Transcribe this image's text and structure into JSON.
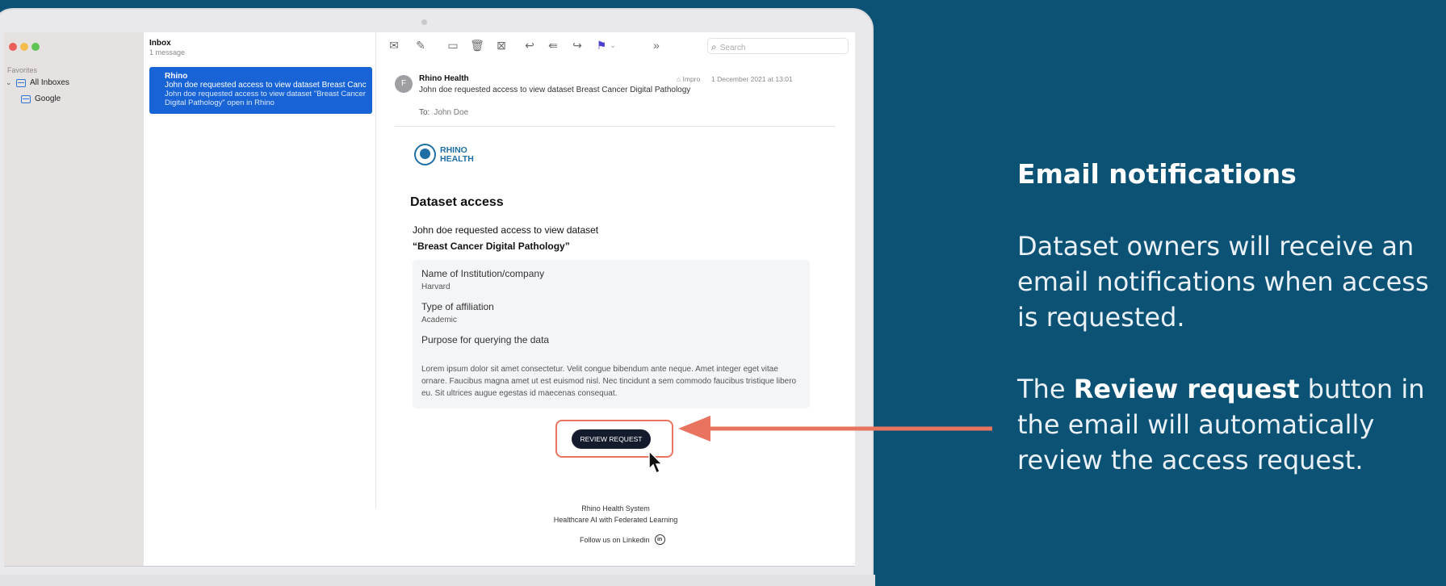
{
  "sidebar": {
    "favorites_label": "Favorites",
    "all_inboxes": "All Inboxes",
    "google": "Google"
  },
  "message_list": {
    "title": "Inbox",
    "count": "1 message",
    "item": {
      "from": "Rhino",
      "subject": "John doe requested access to view dataset Breast Canc",
      "preview": "John doe requested access to view dataset \"Breast Cancer Digital Pathology\" open in Rhino"
    }
  },
  "toolbar": {
    "icons": [
      "envelope-icon",
      "compose-icon",
      "archive-icon",
      "trash-icon",
      "junk-icon",
      "reply-icon",
      "reply-all-icon",
      "forward-icon",
      "flag-icon",
      "more-icon"
    ],
    "search_placeholder": "Search",
    "flag_color": "#4a3fcf"
  },
  "email": {
    "avatar": "F",
    "from": "Rhino Health",
    "subject": "John doe requested access to view dataset Breast Cancer Digital Pathology",
    "mailbox": "Impro",
    "date": "1 December 2021 at 13:01",
    "to_label": "To:",
    "to_value": "John Doe",
    "logo_line1": "RHINO",
    "logo_line2": "HEALTH",
    "title": "Dataset access",
    "body_line1": "John doe requested access to view dataset",
    "body_line2": "“Breast Cancer Digital Pathology”",
    "fields": {
      "institution_label": "Name of Institution/company",
      "institution_value": "Harvard",
      "affiliation_label": "Type of affiliation",
      "affiliation_value": "Academic",
      "purpose_label": "Purpose for querying the data",
      "purpose_value": "Lorem ipsum dolor sit amet consectetur. Velit congue bibendum ante neque. Amet integer eget vitae ornare. Faucibus magna amet ut est euismod nisl. Nec tincidunt a sem commodo faucibus tristique libero eu. Sit ultrices augue egestas id maecenas consequat."
    },
    "review_button": "REVIEW REQUEST",
    "footer_line1": "Rhino Health System",
    "footer_line2": "Healthcare AI with Federated Learning",
    "footer_line3": "Follow us on Linkedin",
    "linkedin_glyph": "in"
  },
  "panel": {
    "title": "Email notifications",
    "p1": "Dataset owners will receive an email notifications when access is requested.",
    "p2_pre": "The ",
    "p2_bold": "Review request",
    "p2_post": " button in the email will automatically review the access request."
  },
  "colors": {
    "background": "#0b5275",
    "accent_arrow": "#e8745f",
    "selection": "#1864d6",
    "brand": "#1d6fa5"
  }
}
